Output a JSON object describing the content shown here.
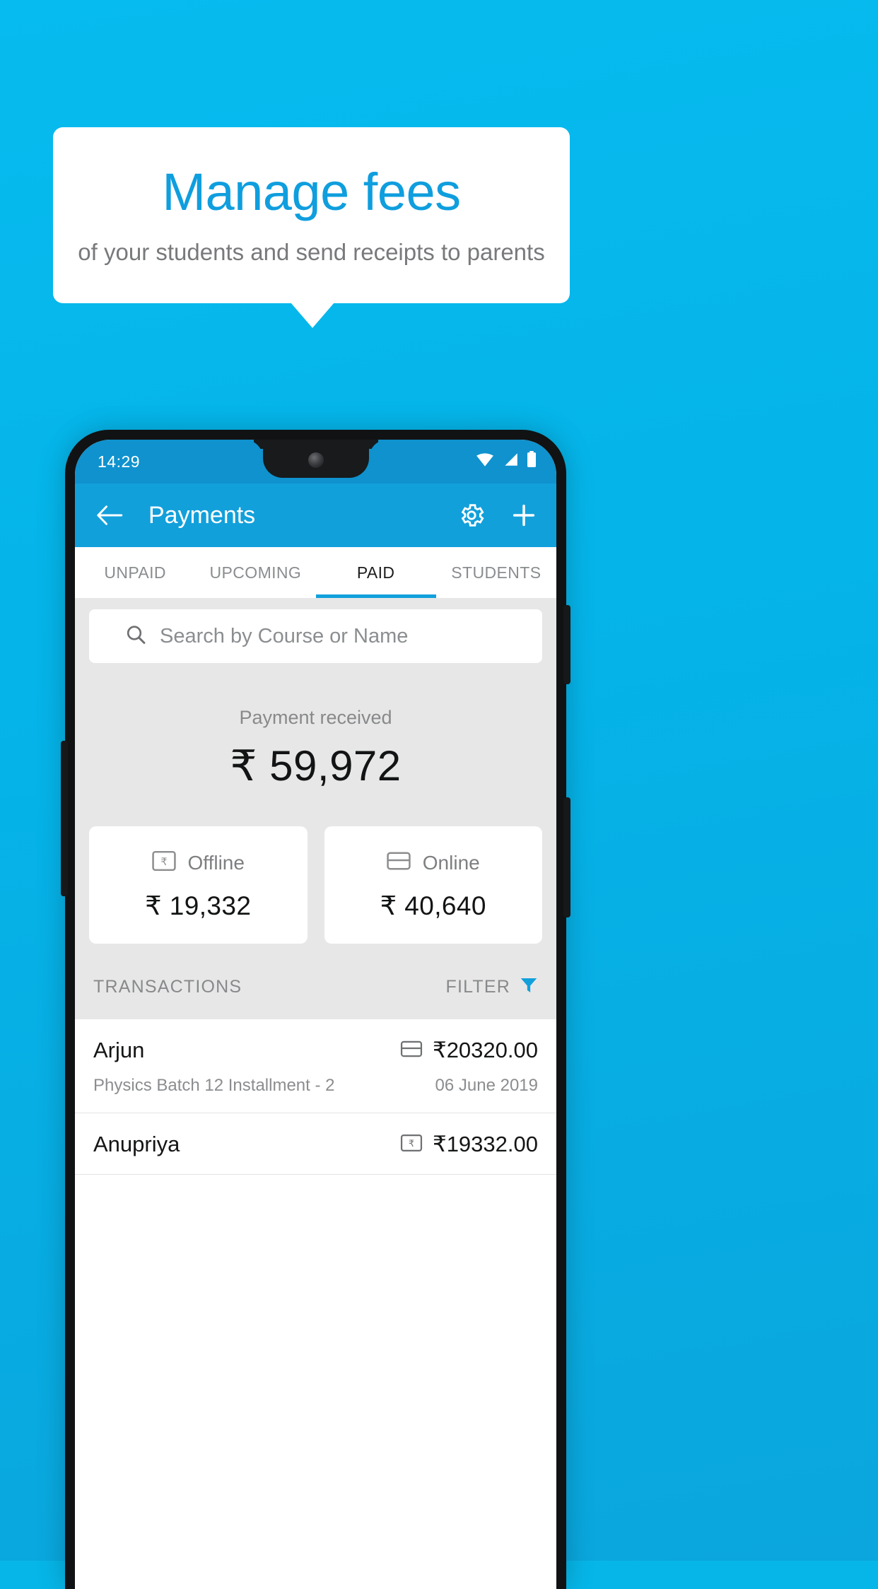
{
  "promo": {
    "title": "Manage fees",
    "subtitle": "of your students and send receipts to parents",
    "brand_color": "#06bbef",
    "title_color": "#0f9ede"
  },
  "statusbar": {
    "time": "14:29",
    "icons": [
      "wifi-icon",
      "signal-icon",
      "battery-icon"
    ]
  },
  "appbar": {
    "back_icon": "back-arrow-icon",
    "title": "Payments",
    "settings_icon": "gear-icon",
    "add_icon": "plus-icon",
    "background": "#12a0db"
  },
  "tabs": [
    {
      "label": "UNPAID",
      "active": false
    },
    {
      "label": "UPCOMING",
      "active": false
    },
    {
      "label": "PAID",
      "active": true
    },
    {
      "label": "STUDENTS",
      "active": false
    }
  ],
  "search": {
    "placeholder": "Search by Course or Name",
    "value": "",
    "icon": "search-icon"
  },
  "summary": {
    "label": "Payment received",
    "amount": "₹ 59,972"
  },
  "methods": [
    {
      "icon": "banknote-rupee-icon",
      "label": "Offline",
      "amount": "₹ 19,332"
    },
    {
      "icon": "credit-card-icon",
      "label": "Online",
      "amount": "₹ 40,640"
    }
  ],
  "transactions_header": {
    "title": "TRANSACTIONS",
    "filter_label": "FILTER",
    "filter_icon": "funnel-icon",
    "filter_icon_color": "#12a0db"
  },
  "transactions": [
    {
      "name": "Arjun",
      "amount": "₹20320.00",
      "method_icon": "credit-card-icon",
      "description": "Physics Batch 12 Installment - 2",
      "date": "06 June 2019"
    },
    {
      "name": "Anupriya",
      "amount": "₹19332.00",
      "method_icon": "banknote-rupee-icon",
      "description": "",
      "date": ""
    }
  ]
}
